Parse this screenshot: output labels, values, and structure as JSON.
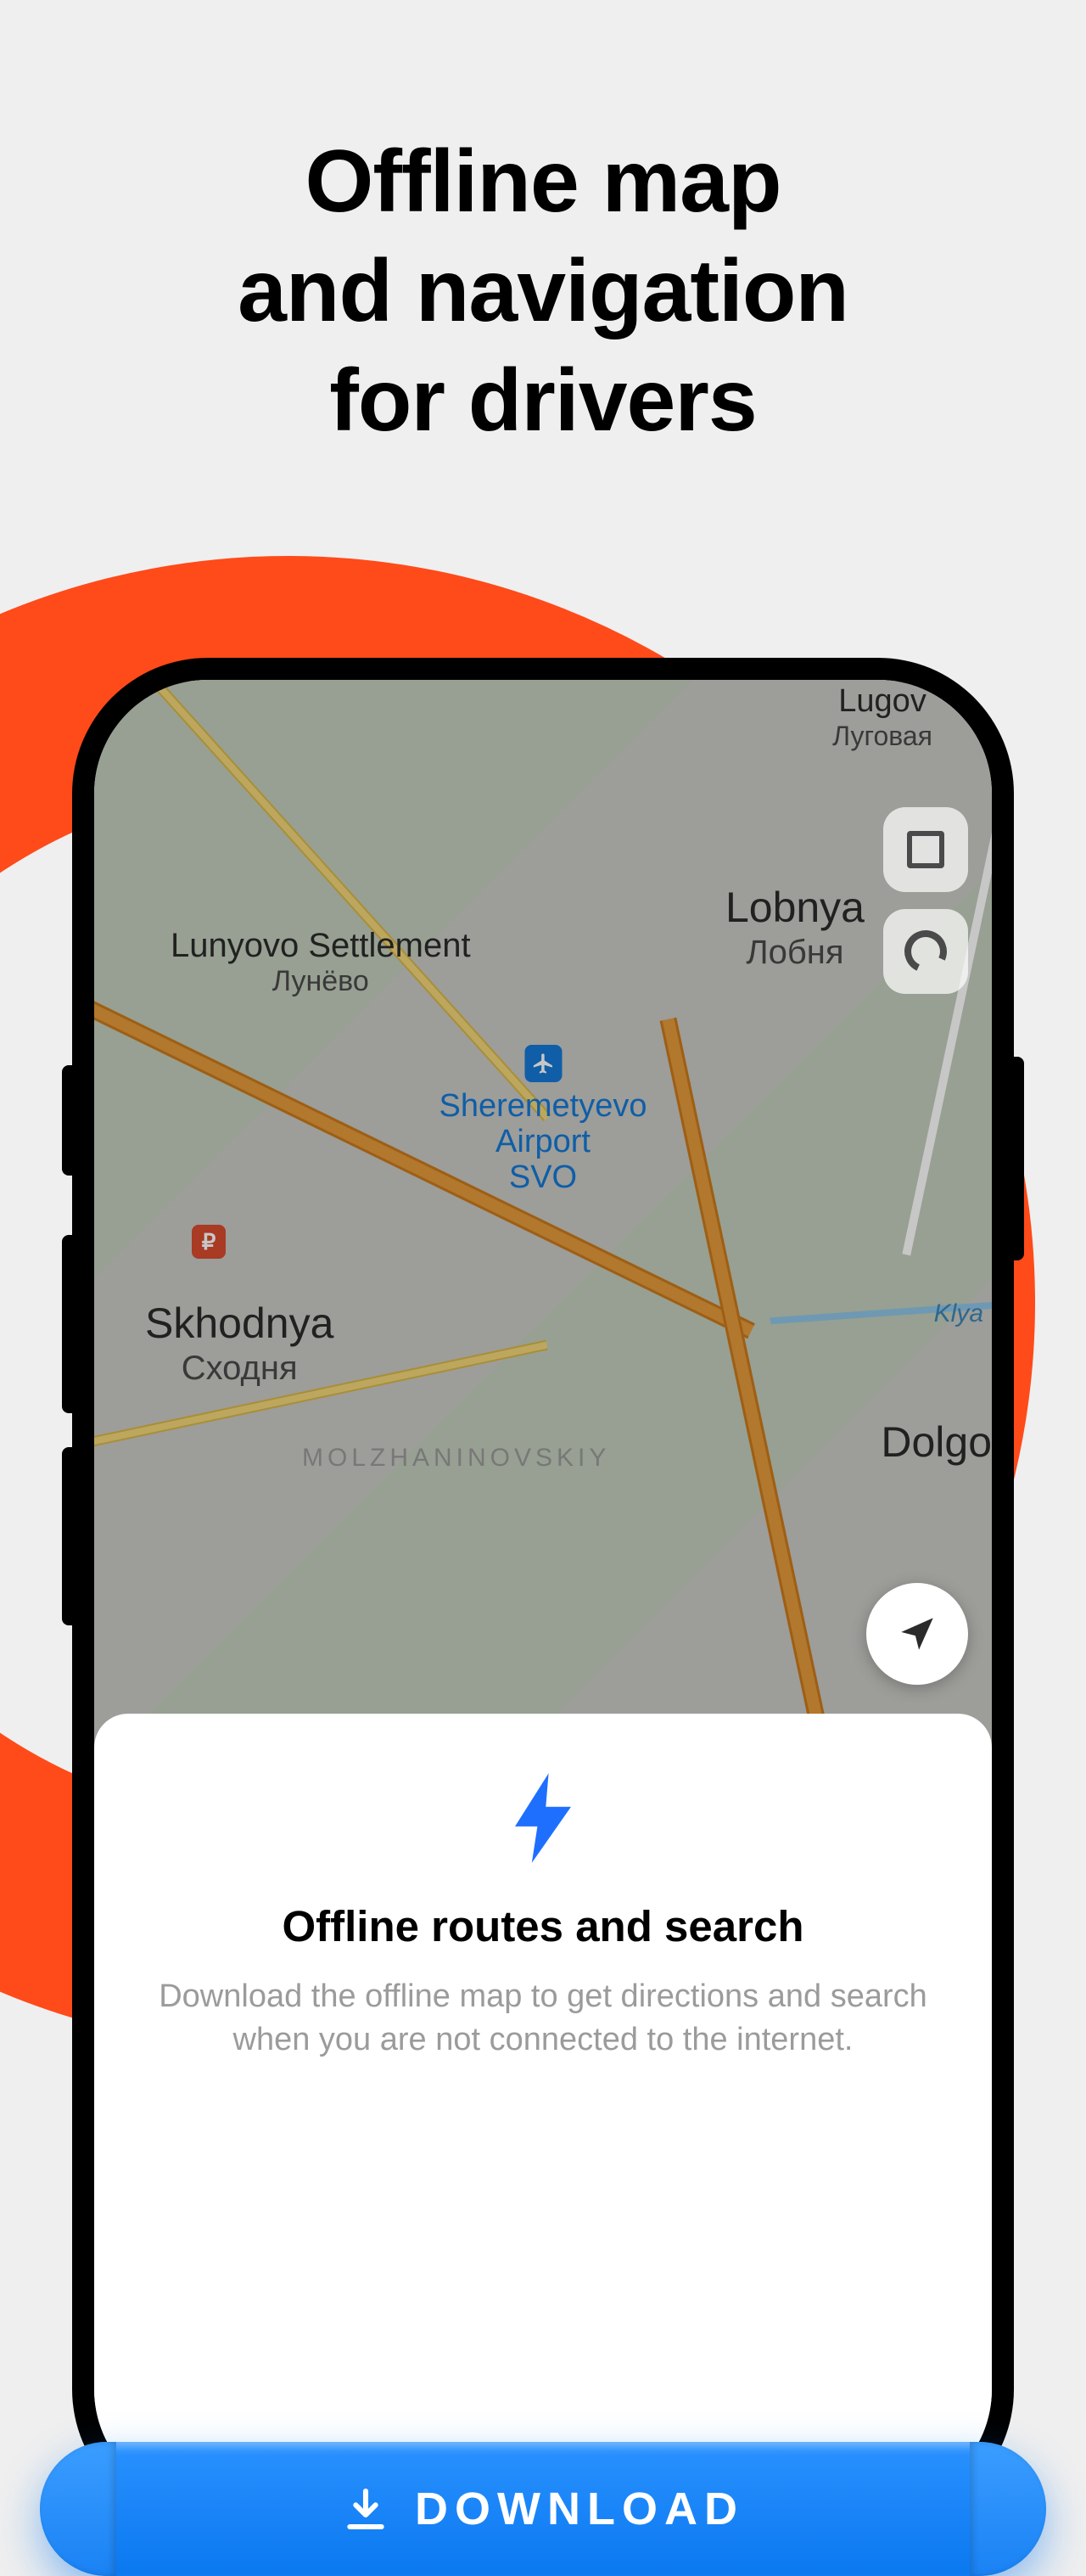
{
  "headline": {
    "line1": "Offline map",
    "line2": "and navigation",
    "line3": "for drivers"
  },
  "map": {
    "labels": {
      "lugov_en": "Lugov",
      "lugov_ru": "Луговая",
      "lunyovo_en": "Lunyovo Settlement",
      "lunyovo_ru": "Лунёво",
      "lobnya_en": "Lobnya",
      "lobnya_ru": "Лобня",
      "skhodnya_en": "Skhodnya",
      "skhodnya_ru": "Сходня",
      "dolgo_en": "Dolgo",
      "molzh": "MOLZHANINOVSKIY",
      "river": "Klya"
    },
    "airport": {
      "line1": "Sheremetyevo",
      "line2": "Airport",
      "line3": "SVO"
    },
    "toll_symbol": "₽"
  },
  "sheet": {
    "title": "Offline routes and search",
    "description": "Download the offline map to get directions and search when you are not connected to the internet."
  },
  "download_button": "DOWNLOAD",
  "colors": {
    "accent_orange": "#ff4a1a",
    "accent_blue": "#1479d6",
    "button_blue": "#0a78f0"
  }
}
